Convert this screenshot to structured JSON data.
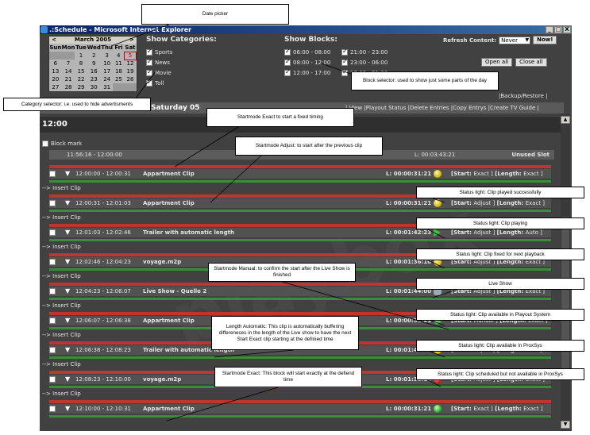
{
  "window": {
    "title": ".:Schedule - Microsoft Internet Explorer"
  },
  "calendar": {
    "month": "March 2005",
    "prev": "<",
    "next": ">",
    "day_names": [
      "Sun",
      "Mon",
      "Tue",
      "Wed",
      "Thu",
      "Fri",
      "Sat"
    ],
    "weeks": [
      [
        "",
        "",
        "1",
        "2",
        "3",
        "4",
        "5"
      ],
      [
        "6",
        "7",
        "8",
        "9",
        "10",
        "11",
        "12"
      ],
      [
        "13",
        "14",
        "15",
        "16",
        "17",
        "18",
        "19"
      ],
      [
        "20",
        "21",
        "22",
        "23",
        "24",
        "25",
        "26"
      ],
      [
        "27",
        "28",
        "29",
        "30",
        "31",
        "",
        ""
      ]
    ]
  },
  "categories": {
    "title": "Show Categories:",
    "items": [
      "Sports",
      "News",
      "Movie",
      "Toll"
    ]
  },
  "blocks": {
    "title": "Show Blocks:",
    "items": [
      "06:00 - 08:00",
      "21:00 - 23:00",
      "08:00 - 12:00",
      "23:00 - 06:00",
      "12:00 - 17:00",
      "17:00 - 21:00"
    ]
  },
  "refresh": {
    "label": "Refresh Content:",
    "value": "Never",
    "now": "Now!"
  },
  "buttons": {
    "open_all": "Open all",
    "close_all": "Close all",
    "backup": "|Backup/Restore |"
  },
  "day": {
    "title": "Saturday 05",
    "links": "| View |Playout Status |Delete Entries |Copy Entrys |Create TV Guide |"
  },
  "hour": "12:00",
  "block_mark": "Block mark",
  "unused": {
    "time": "11:56:16 - 12:00:00",
    "length": "L: 00:03:43:21",
    "label": "Unused Slot"
  },
  "insert_label": "--> Insert Clip",
  "clips": [
    {
      "time": "12:00:00 - 12:00:31",
      "name": "Appartment Clip",
      "len": "L: 00:00:31:21",
      "icon": "smile",
      "start_lbl": "[Start:",
      "start": "Exact ]",
      "length_lbl": "[Length:",
      "length": "Exact ]"
    },
    {
      "time": "12:00:31 - 12:01:03",
      "name": "Appartment Clip",
      "len": "L: 00:00:31:21",
      "icon": "smile",
      "start_lbl": "[Start:",
      "start": "Adjust ]",
      "length_lbl": "[Length:",
      "length": "Exact ]"
    },
    {
      "time": "12:01:03 - 12:02:46",
      "name": "Trailer with automatic length",
      "len": "L: 00:01:42:23",
      "icon": "play",
      "start_lbl": "[Start:",
      "start": "Adjust ]",
      "length_lbl": "[Length:",
      "length": "Auto ]"
    },
    {
      "time": "12:02:46 - 12:04:23",
      "name": "voyage.m2p",
      "len": "L: 00:01:36:10",
      "icon": "yellow",
      "start_lbl": "[Start:",
      "start": "Adjust ]",
      "length_lbl": "[Length:",
      "length": "Exact ]"
    },
    {
      "time": "12:04:23 - 12:06:07",
      "name": "Live Show  - Quelle 2",
      "len": "L: 00:01:44:00",
      "icon": "live",
      "start_lbl": "[Start:",
      "start": "Adjust ]",
      "length_lbl": "[Length:",
      "length": "Exact ]"
    },
    {
      "time": "12:06:07 - 12:06:38",
      "name": "Appartment Clip",
      "len": "L: 00:00:31:21",
      "icon": "green",
      "start_lbl": "[Start:",
      "start": "Manual ]",
      "length_lbl": "[Length:",
      "length": "Exact ]"
    },
    {
      "time": "12:06:38 - 12:08:23",
      "name": "Trailer with automatic length",
      "len": "L: 00:01:44:19",
      "icon": "yellow",
      "start_lbl": "[Start:",
      "start": "Adjust ]",
      "length_lbl": "[Length:",
      "length": "Auto ]"
    },
    {
      "time": "12:08:23 - 12:10:00",
      "name": "voyage.m2p",
      "len": "L: 00:01:36:10",
      "icon": "red",
      "start_lbl": "[Start:",
      "start": "Adjust ]",
      "length_lbl": "[Length:",
      "length": "Exact ]"
    },
    {
      "time": "12:10:00 - 12:10:31",
      "name": "Appartment Clip",
      "len": "L: 00:00:31:21",
      "icon": "green",
      "start_lbl": "[Start:",
      "start": "Exact ]",
      "length_lbl": "[Length:",
      "length": "Exact ]"
    }
  ],
  "watermark": "playbox",
  "callouts": {
    "date_picker": "Date picker",
    "block_selector": "Block selector: used to show just some parts of the day",
    "category_selector": "Category selector: i.e. used to hide advertisments",
    "startmode_exact": "Startmode Exact to start a fixed timing",
    "startmode_adjust": "Startmode Adjust: to start after the previous clip",
    "status_played": "Status light: Clip played successfully",
    "status_playing": "Status light: Clip playing",
    "status_fixed": "Status light: Clip fixed for next playback",
    "startmode_manual": "Startmode Manual: to confirm the start after the Live Show is finished",
    "live_show": "Live Show",
    "status_playout": "Status light: Clip available in Playout System",
    "length_auto": "Length Automatic: This clip is automatically buffering differeneces in the length of the Live show to have the next Start Exact clip starting at the definied time",
    "status_proxsys": "Status light: Clip available in ProxSys",
    "status_scheduled": "Status light: Clip scheduled but not available in ProxSys",
    "startmode_exact_block": "Startmode Exact: This block will start exactly at the defiend time"
  }
}
